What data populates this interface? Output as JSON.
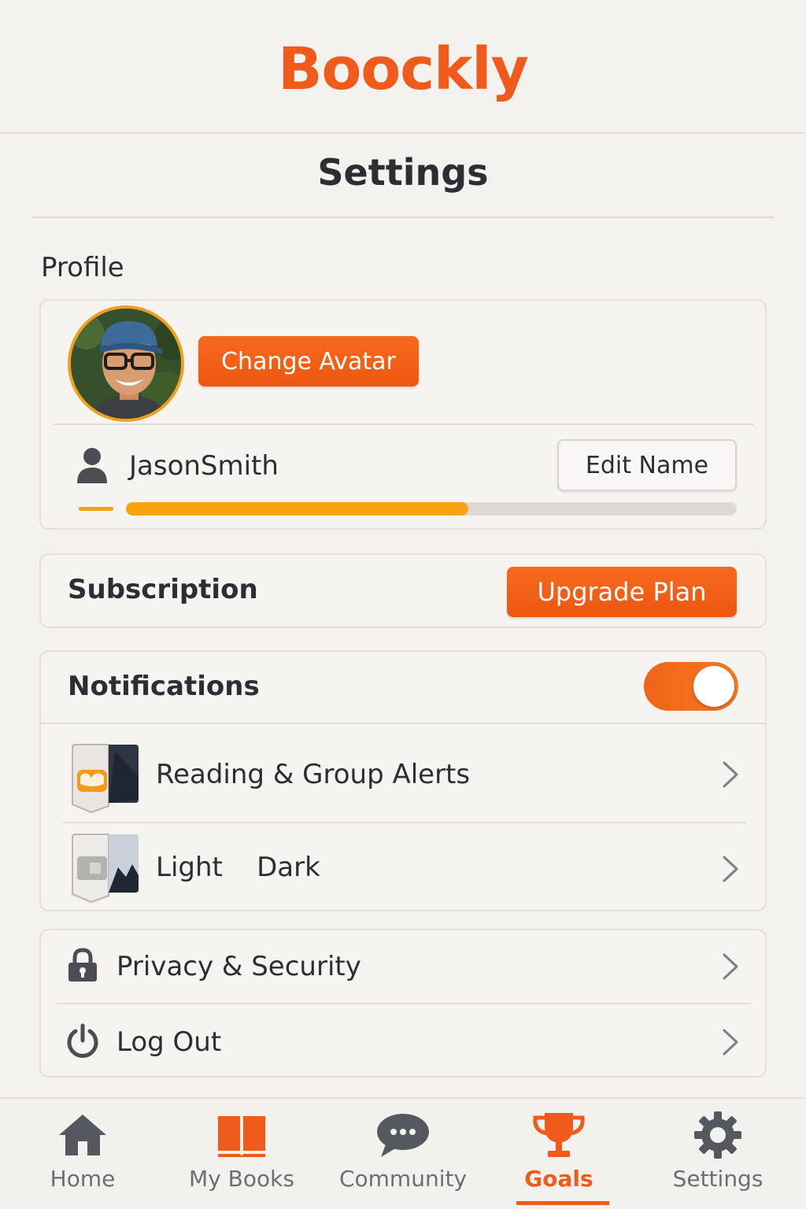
{
  "app": {
    "brand": "Boockly"
  },
  "page": {
    "title": "Settings",
    "section_profile": "Profile"
  },
  "profile": {
    "change_avatar_label": "Change Avatar",
    "username": "JasonSmith",
    "edit_name_label": "Edit Name",
    "progress_fraction": 0.56
  },
  "subscription": {
    "label": "Subscription",
    "upgrade_label": "Upgrade Plan"
  },
  "notifications": {
    "label": "Notifications",
    "enabled": true,
    "rows": [
      {
        "label": "Reading & Group Alerts",
        "icon": "alerts-app-icon"
      },
      {
        "label": "Light    Dark",
        "icon": "theme-app-icon"
      }
    ]
  },
  "misc": {
    "rows": [
      {
        "label": "Privacy & Security",
        "icon": "lock-icon"
      },
      {
        "label": "Log Out",
        "icon": "power-icon"
      }
    ]
  },
  "tabbar": {
    "tabs": [
      {
        "label": "Home",
        "icon": "home-icon"
      },
      {
        "label": "My Books",
        "icon": "book-icon"
      },
      {
        "label": "Community",
        "icon": "chat-bubble-icon"
      },
      {
        "label": "Goals",
        "icon": "trophy-icon",
        "active": true
      },
      {
        "label": "Settings",
        "icon": "gear-icon"
      }
    ]
  },
  "colors": {
    "accent": "#f05a1a",
    "progress": "#f6a30f",
    "background": "#f4f2ef"
  }
}
